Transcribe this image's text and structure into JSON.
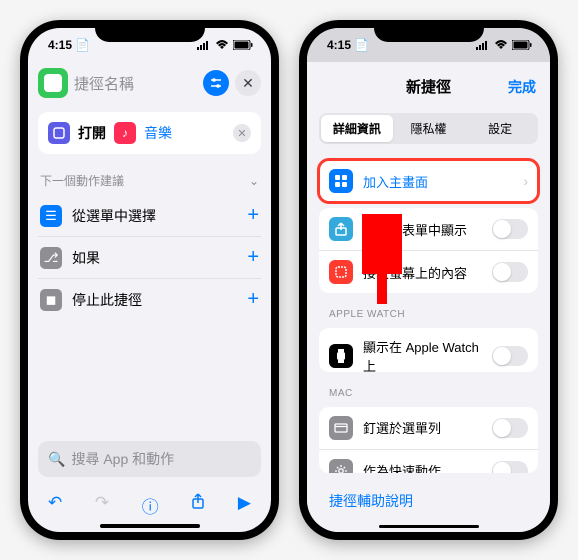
{
  "status": {
    "time": "4:15",
    "doc_icon": "📄"
  },
  "left": {
    "title_placeholder": "捷徑名稱",
    "action": {
      "open_label": "打開",
      "app_label": "音樂"
    },
    "suggestions_header": "下一個動作建議",
    "suggestions": [
      {
        "label": "從選單中選擇"
      },
      {
        "label": "如果"
      },
      {
        "label": "停止此捷徑"
      }
    ],
    "search_placeholder": "搜尋 App 和動作"
  },
  "right": {
    "sheet_title": "新捷徑",
    "done_label": "完成",
    "tabs": {
      "details": "詳細資訊",
      "privacy": "隱私權",
      "settings": "設定"
    },
    "group1": [
      {
        "label": "加入主畫面",
        "type": "link"
      }
    ],
    "group2": [
      {
        "label": "在分享表單中顯示",
        "type": "switch"
      },
      {
        "label": "接收螢幕上的內容",
        "type": "switch"
      }
    ],
    "section_watch": "APPLE WATCH",
    "group3": [
      {
        "label": "顯示在 Apple Watch 上",
        "type": "switch"
      }
    ],
    "section_mac": "MAC",
    "group4": [
      {
        "label": "釘選於選單列",
        "type": "switch"
      },
      {
        "label": "作為快速動作",
        "type": "switch"
      }
    ],
    "help_link": "捷徑輔助說明"
  }
}
